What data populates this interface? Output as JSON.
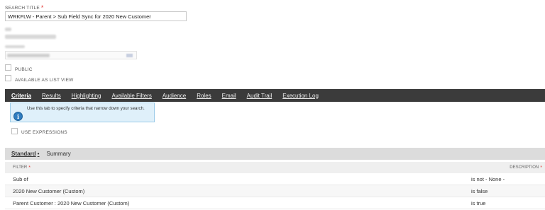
{
  "search_title": {
    "label": "SEARCH TITLE",
    "value": "WRKFLW - Parent > Sub Field Sync for 2020 New Customer"
  },
  "checkboxes": {
    "public": "PUBLIC",
    "available_as_list_view": "AVAILABLE AS LIST VIEW",
    "use_expressions": "USE EXPRESSIONS"
  },
  "tabs": [
    {
      "label": "Criteria"
    },
    {
      "label": "Results"
    },
    {
      "label": "Highlighting"
    },
    {
      "label": "Available Filters"
    },
    {
      "label": "Audience"
    },
    {
      "label": "Roles"
    },
    {
      "label": "Email"
    },
    {
      "label": "Audit Trail"
    },
    {
      "label": "Execution Log"
    }
  ],
  "tooltip": {
    "text": "Use this tab to specify criteria that narrow down your search.",
    "icon": "info-icon"
  },
  "criteria": {
    "subtabs": {
      "standard": "Standard",
      "summary": "Summary"
    },
    "columns": {
      "filter": "FILTER",
      "description": "DESCRIPTION"
    },
    "rows": [
      {
        "filter": "Sub of",
        "description": "is not - None -"
      },
      {
        "filter": "2020 New Customer (Custom)",
        "description": "is false"
      },
      {
        "filter": "Parent Customer : 2020 New Customer (Custom)",
        "description": "is true"
      }
    ]
  },
  "colors": {
    "tabbar": "#3b3b3b",
    "required": "#e53935",
    "tooltip_bg": "#dff0fa"
  }
}
